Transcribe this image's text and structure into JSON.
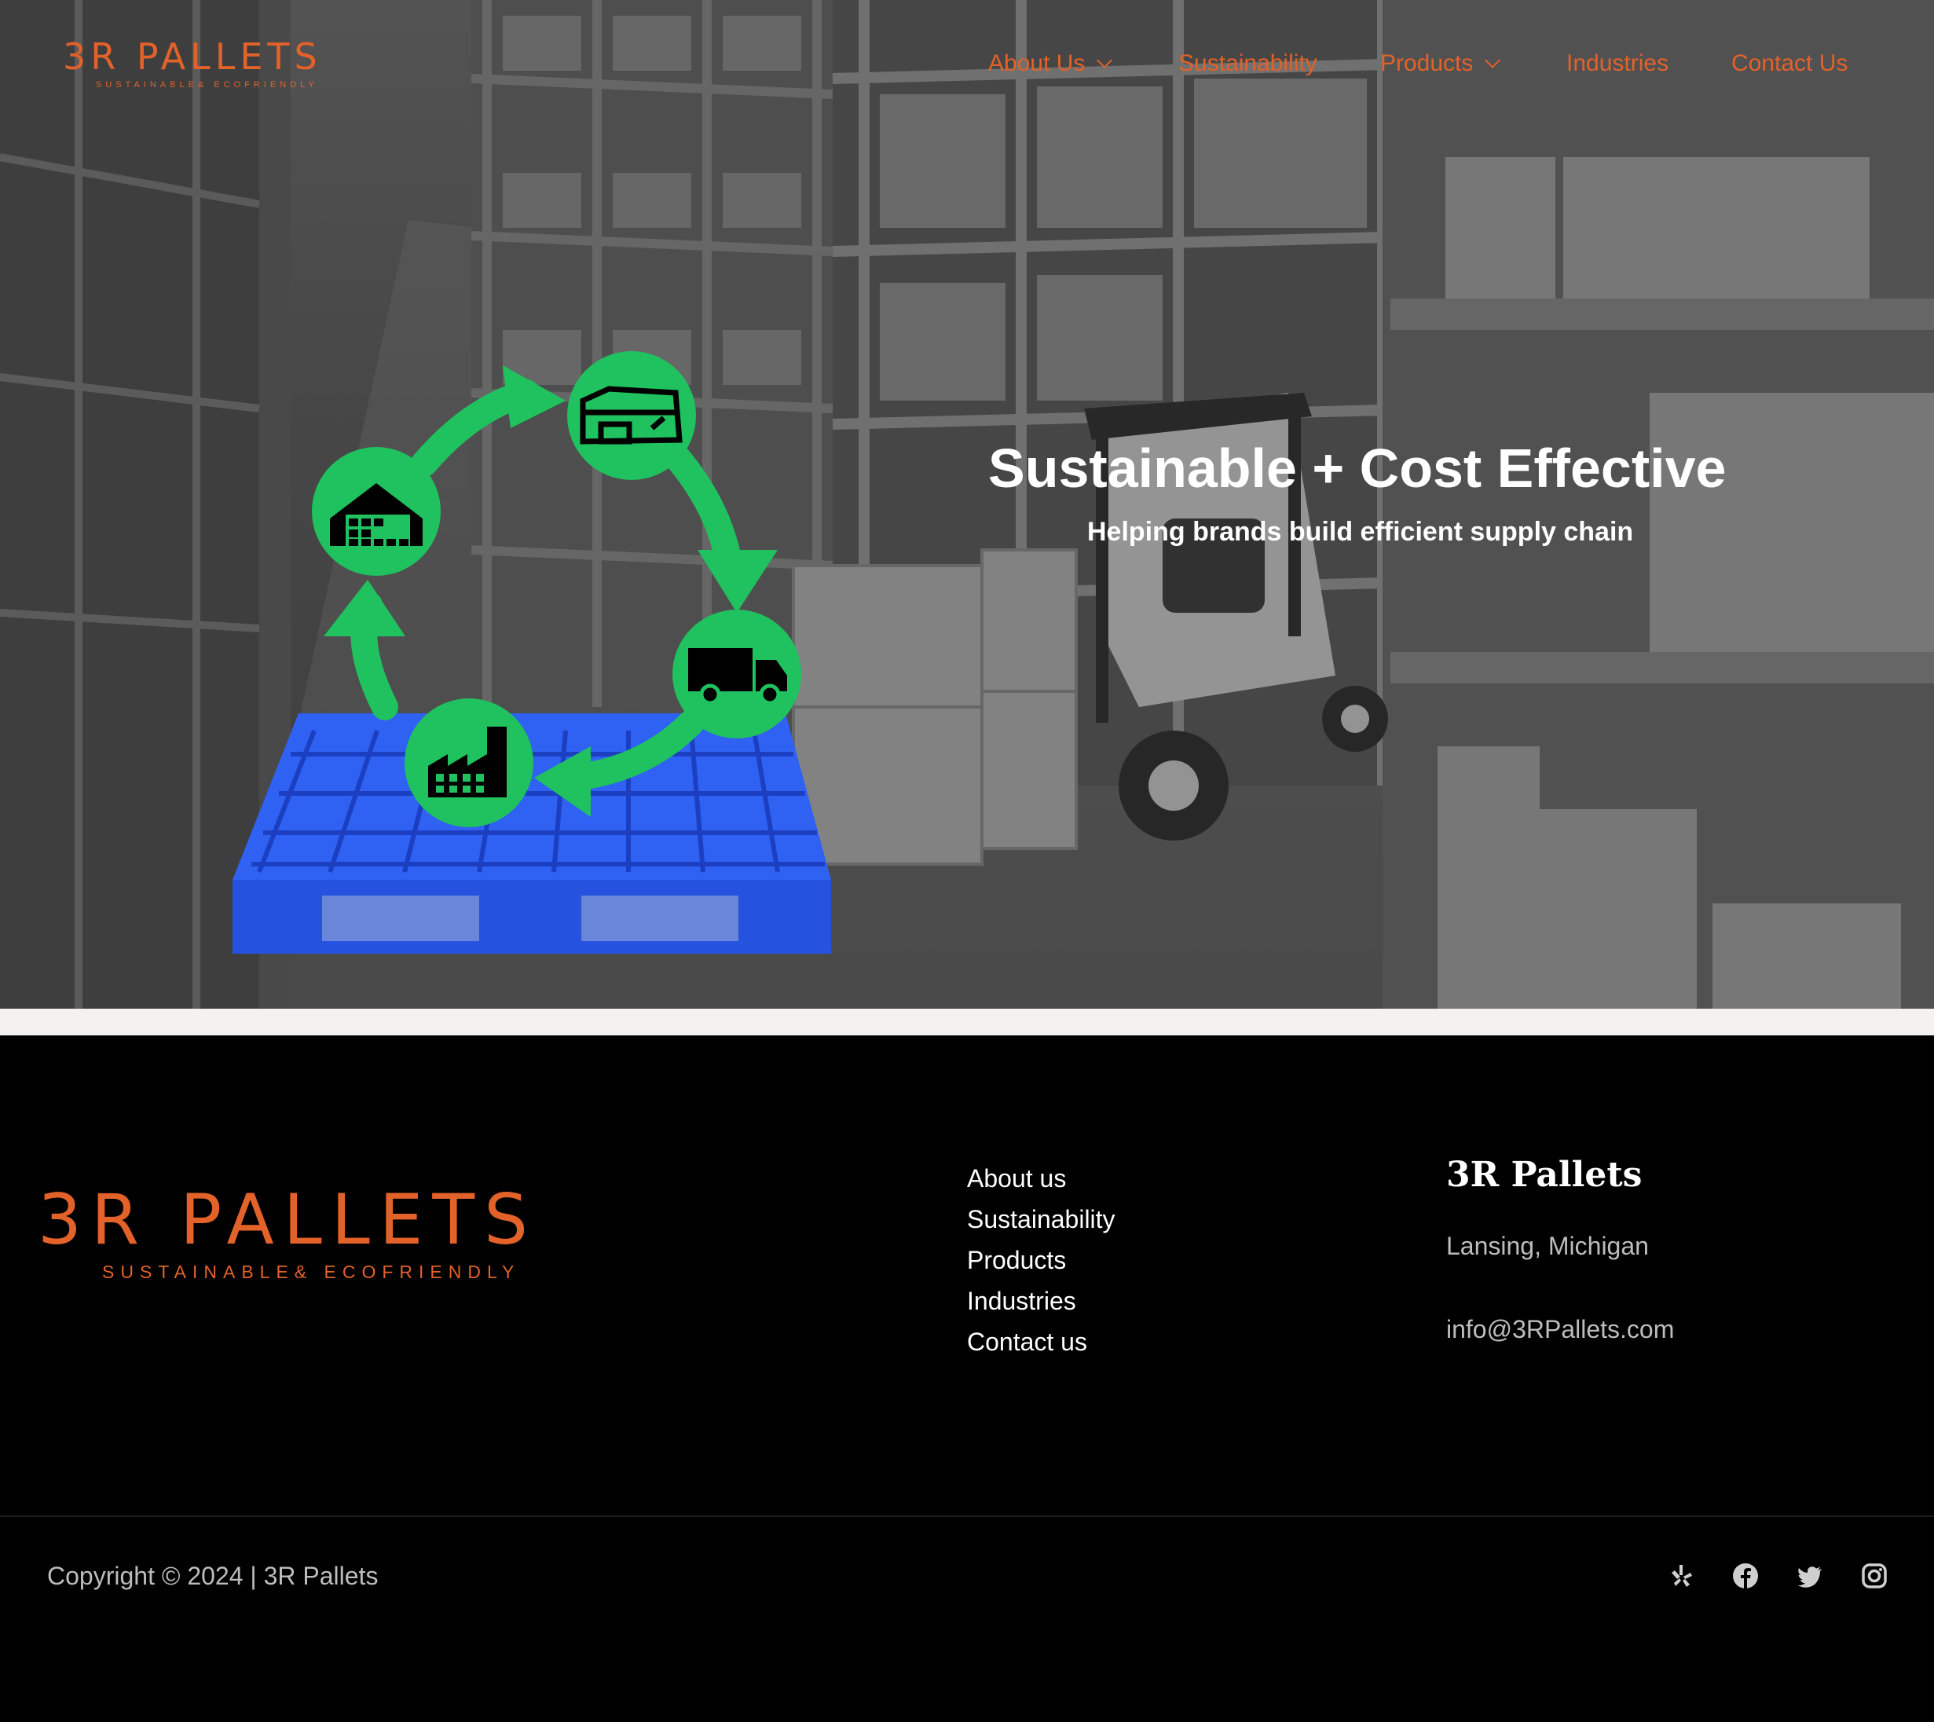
{
  "brand": {
    "logo_text": "3R PALLETS",
    "logo_tagline": "SUSTAINABLE& ECOFRIENDLY",
    "accent_color": "#e2622a"
  },
  "nav": {
    "items": [
      {
        "label": "About Us",
        "has_dropdown": true
      },
      {
        "label": "Sustainability",
        "has_dropdown": false
      },
      {
        "label": "Products",
        "has_dropdown": true
      },
      {
        "label": "Industries",
        "has_dropdown": false
      },
      {
        "label": "Contact Us",
        "has_dropdown": false
      }
    ]
  },
  "hero": {
    "headline": "Sustainable + Cost Effective",
    "subheadline": "Helping brands build efficient supply chain",
    "cycle_icons": [
      "warehouse-icon",
      "distribution-center-icon",
      "truck-icon",
      "factory-icon"
    ],
    "cycle_color": "#1fc25f",
    "pallet_color": "#2a5cf0"
  },
  "footer": {
    "logo_text": "3R PALLETS",
    "logo_tagline": "SUSTAINABLE& ECOFRIENDLY",
    "links": [
      "About us",
      "Sustainability",
      "Products",
      "Industries",
      "Contact us"
    ],
    "company_name": "3R Pallets",
    "address": "Lansing, Michigan",
    "email": "info@3RPallets.com",
    "copyright": "Copyright © 2024 | 3R Pallets",
    "social": [
      "yelp-icon",
      "facebook-icon",
      "twitter-icon",
      "instagram-icon"
    ]
  }
}
